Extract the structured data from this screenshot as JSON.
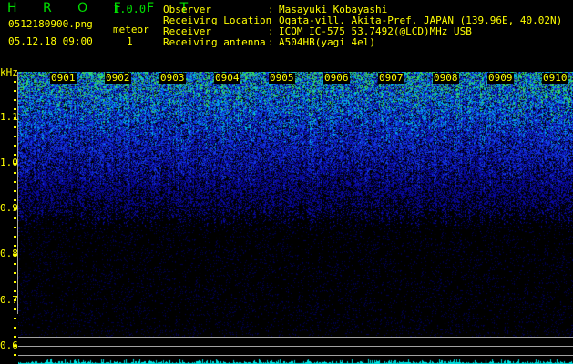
{
  "app": {
    "title": "H R O F F T",
    "version": "1.0.0"
  },
  "file": {
    "name": "0512180900.png",
    "datetime": "05.12.18 09:00"
  },
  "meteor": {
    "label": "meteor",
    "count": "1"
  },
  "info": [
    {
      "label": "Observer",
      "sep": ":",
      "value": "Masayuki Kobayashi"
    },
    {
      "label": "Receiving Location",
      "sep": ":",
      "value": "Ogata-vill. Akita-Pref. JAPAN (139.96E, 40.02N)"
    },
    {
      "label": "Receiver",
      "sep": ":",
      "value": "ICOM IC-575 53.7492(@LCD)MHz USB"
    },
    {
      "label": "Receiving antenna",
      "sep": ":",
      "value": "A504HB(yagi 4el)"
    }
  ],
  "y_axis": {
    "unit": "kHz",
    "ticks": [
      "1.1",
      "1.0",
      "0.9",
      "0.8",
      "0.7",
      "0.6"
    ]
  },
  "time_labels": [
    "0901",
    "0902",
    "0903",
    "0904",
    "0905",
    "0906",
    "0907",
    "0908",
    "0909",
    "0910"
  ],
  "colors": {
    "text": "#ffff00",
    "title": "#00e000",
    "grid": "#a0a0a0",
    "trace": "#00e0e0"
  }
}
